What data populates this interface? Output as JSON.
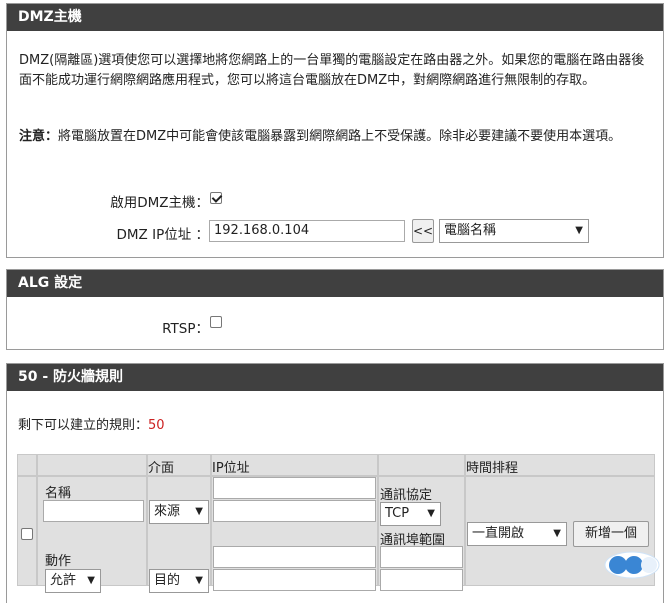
{
  "dmz": {
    "title": "DMZ主機",
    "description": "DMZ(隔離區)選項使您可以選擇地將您網路上的一台單獨的電腦設定在路由器之外。如果您的電腦在路由器後面不能成功運行網際網路應用程式，您可以將這台電腦放在DMZ中，對網際網路進行無限制的存取。",
    "note_label": "注意：",
    "note_text": "將電腦放置在DMZ中可能會使該電腦暴露到網際網路上不受保護。除非必要建議不要使用本選項。",
    "enable_label": "啟用DMZ主機：",
    "enable_checked": true,
    "ip_label": "DMZ IP位址 ：",
    "ip_value": "192.168.0.104",
    "copy_button": "<<",
    "computer_select": "電腦名稱"
  },
  "alg": {
    "title": "ALG 設定",
    "rtsp_label": "RTSP：",
    "rtsp_checked": false
  },
  "firewall": {
    "title": "50 - 防火牆規則",
    "remaining_label": "剩下可以建立的規則：",
    "remaining_count": "50",
    "headers": {
      "interface": "介面",
      "ip": "IP位址",
      "schedule": "時間排程"
    },
    "name_label": "名稱",
    "source_select": "來源",
    "protocol_label": "通訊協定",
    "protocol_select": "TCP",
    "port_range_label": "通訊埠範圍",
    "schedule_select": "一直開啟",
    "add_button": "新增一個",
    "action_label": "動作",
    "action_select": "允許",
    "dest_select": "目的"
  },
  "colors": {
    "header_bg": "#404040",
    "count_color": "#cc2222"
  }
}
